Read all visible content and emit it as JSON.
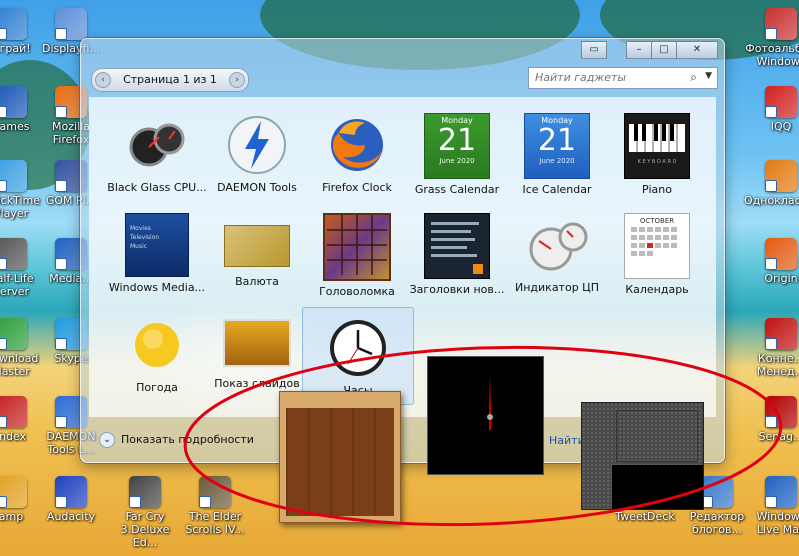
{
  "window": {
    "pager": {
      "prev": "‹",
      "text": "Страница 1 из 1",
      "next": "›"
    },
    "search_placeholder": "Найти гаджеты",
    "gadgets": [
      {
        "label": "Black Glass CPU..."
      },
      {
        "label": "DAEMON Tools"
      },
      {
        "label": "Firefox Clock"
      },
      {
        "label": "Grass Calendar",
        "month": "Monday",
        "day": "21",
        "sub": "June 2020"
      },
      {
        "label": "Ice Calendar",
        "month": "Monday",
        "day": "21",
        "sub": "June 2020"
      },
      {
        "label": "Piano",
        "sub": "K E Y B O A R D"
      },
      {
        "label": "Windows Media...",
        "lines": [
          "Movies",
          "Television",
          "Music"
        ]
      },
      {
        "label": "Валюта"
      },
      {
        "label": "Головоломка"
      },
      {
        "label": "Заголовки нов..."
      },
      {
        "label": "Индикатор ЦП"
      },
      {
        "label": "Календарь",
        "month": "OCTOBER"
      },
      {
        "label": "Погода"
      },
      {
        "label": "Показ слайдов"
      },
      {
        "label": "Часы"
      }
    ],
    "details_label": "Показать подробности",
    "find_online": "Найти"
  },
  "desktop_icons": [
    {
      "label": "Играй!",
      "color": "#2f7fd0"
    },
    {
      "label": "Displayfi...",
      "color": "#5a8fd8"
    },
    {
      "label": "games",
      "color": "#1b57b8"
    },
    {
      "label": "Mozilla Firefox",
      "color": "#e66b12"
    },
    {
      "label": "QuickTime Player",
      "color": "#3aa0e0"
    },
    {
      "label": "GOM Pl...",
      "color": "#3050a0"
    },
    {
      "label": "Half-Life Server",
      "color": "#555555"
    },
    {
      "label": "Media...",
      "color": "#2060c0"
    },
    {
      "label": "Download Master",
      "color": "#2b9e3a"
    },
    {
      "label": "Skype",
      "color": "#1d9be0"
    },
    {
      "label": "Index",
      "color": "#c62020"
    },
    {
      "label": "DAEMON Tools L...",
      "color": "#2a6bd4"
    },
    {
      "label": "amp",
      "color": "#e0a020"
    },
    {
      "label": "Audacity",
      "color": "#2040c0"
    },
    {
      "label": "Far Cry 3.Deluxe Ed...",
      "color": "#444444"
    },
    {
      "label": "The Elder Scrolls IV...",
      "color": "#6b5a3a"
    },
    {
      "label": "TweetDeck",
      "color": "#3a3a3a"
    },
    {
      "label": "Редактор блогов...",
      "color": "#3a78c8"
    },
    {
      "label": "Фотоальбом Windows",
      "color": "#c83030"
    },
    {
      "label": "IQQ",
      "color": "#d02020"
    },
    {
      "label": "Одноклассники",
      "color": "#e07a10"
    },
    {
      "label": "Origin",
      "color": "#e25a10"
    },
    {
      "label": "Конне... Менед...",
      "color": "#c01010"
    },
    {
      "label": "Senag...",
      "color": "#b00000"
    },
    {
      "label": "Windows Live Mail",
      "color": "#2060c0"
    }
  ],
  "accent_color": "#e00010"
}
